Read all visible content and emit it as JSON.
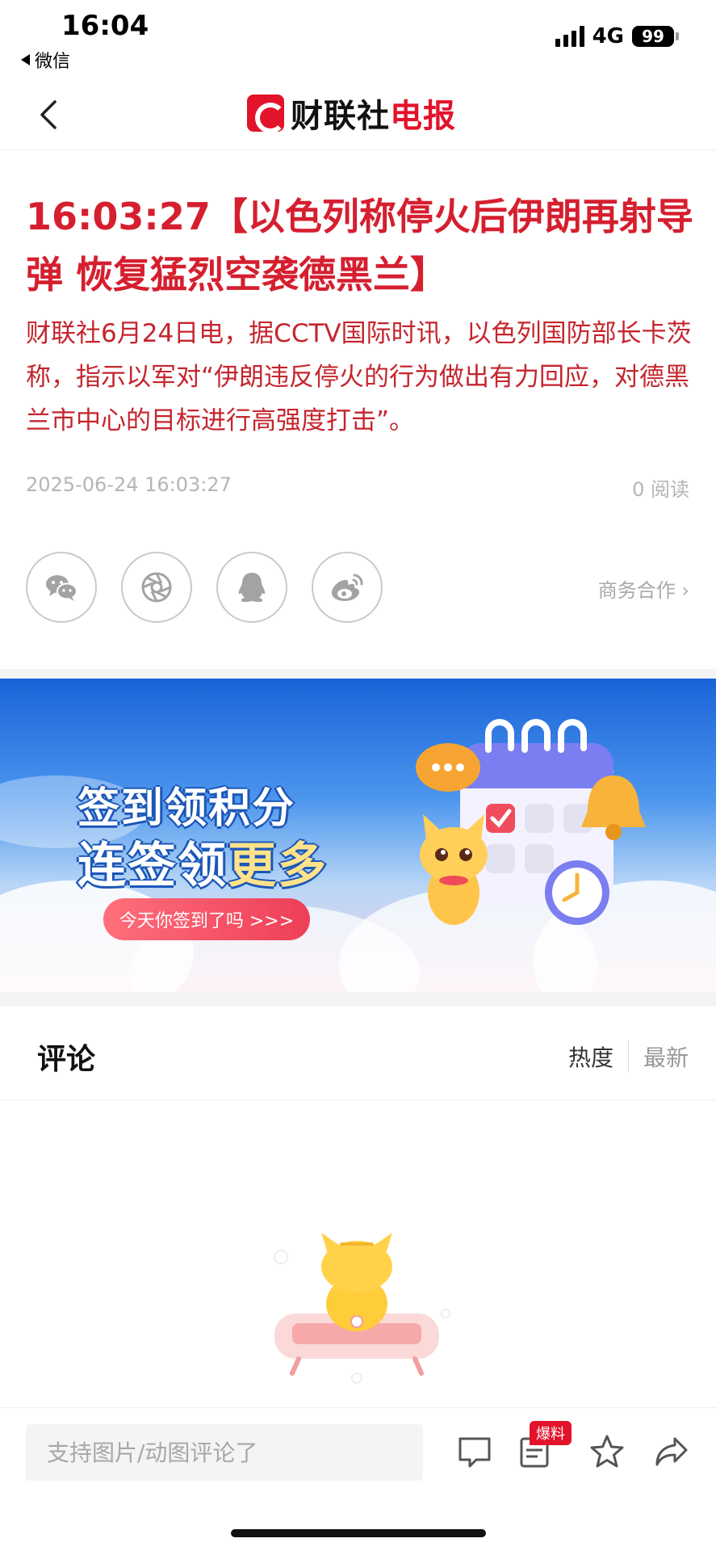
{
  "status_bar": {
    "time": "16:04",
    "back_app": "微信",
    "network": "4G",
    "battery": "99"
  },
  "nav": {
    "brand_black": "财联社",
    "brand_red": "电报"
  },
  "article": {
    "headline": "16:03:27【以色列称停火后伊朗再射导弹 恢复猛烈空袭德黑兰】",
    "body": "财联社6月24日电，据CCTV国际时讯，以色列国防部长卡茨称，指示以军对“伊朗违反停火的行为做出有力回应，对德黑兰市中心的目标进行高强度打击”。",
    "datetime": "2025-06-24 16:03:27",
    "reads": "0 阅读"
  },
  "share": {
    "business": "商务合作 ›",
    "icons": [
      "wechat-icon",
      "moments-icon",
      "qq-icon",
      "weibo-icon"
    ]
  },
  "banner": {
    "line1": "签到领积分",
    "line2a": "连签领",
    "line2b": "更多",
    "cta": "今天你签到了吗 >>>"
  },
  "comments": {
    "title": "评论",
    "sort_hot": "热度",
    "sort_new": "最新"
  },
  "bottom_bar": {
    "placeholder": "支持图片/动图评论了",
    "badge": "爆料"
  },
  "colors": {
    "accent_red": "#e2132a",
    "headline_red": "#d51f2f"
  }
}
